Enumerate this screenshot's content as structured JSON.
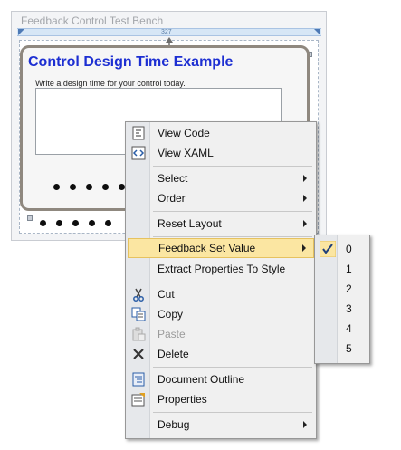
{
  "window": {
    "title": "Feedback Control Test Bench",
    "ruler_width": "327"
  },
  "control": {
    "title": "Control Design Time Example",
    "subtitle": "Write a design time for your control today."
  },
  "context_menu": {
    "items": [
      {
        "label": "View Code",
        "icon": "view-code-icon"
      },
      {
        "label": "View XAML",
        "icon": "view-xaml-icon"
      },
      {
        "label": "Select",
        "submenu": true
      },
      {
        "label": "Order",
        "submenu": true
      },
      {
        "label": "Reset Layout",
        "submenu": true
      },
      {
        "label": "Feedback Set Value",
        "submenu": true,
        "highlighted": true
      },
      {
        "label": "Extract Properties To Style"
      },
      {
        "label": "Cut",
        "icon": "scissors-icon"
      },
      {
        "label": "Copy",
        "icon": "copy-icon"
      },
      {
        "label": "Paste",
        "icon": "paste-icon",
        "disabled": true
      },
      {
        "label": "Delete",
        "icon": "delete-icon"
      },
      {
        "label": "Document Outline",
        "icon": "document-outline-icon"
      },
      {
        "label": "Properties",
        "icon": "properties-icon"
      },
      {
        "label": "Debug",
        "submenu": true
      }
    ]
  },
  "submenu": {
    "checked": "0",
    "items": [
      "0",
      "1",
      "2",
      "3",
      "4",
      "5"
    ]
  },
  "colors": {
    "highlight": "#fbe6a2",
    "control_title": "#1d2fd2",
    "control_border": "#8f887f"
  }
}
